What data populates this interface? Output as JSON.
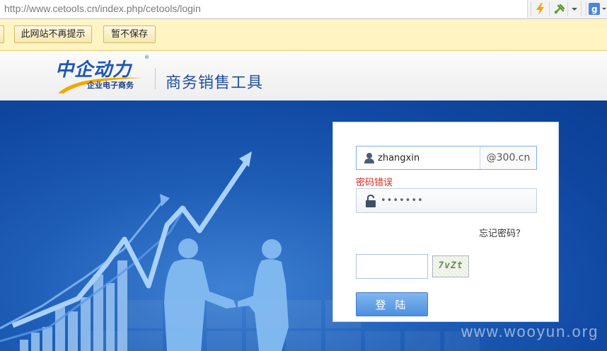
{
  "browser": {
    "url": "http://www.cetools.cn/index.php/cetools/login"
  },
  "notification_bar": {
    "never_save_label": "此网站不再提示",
    "not_now_label": "暂不保存"
  },
  "header": {
    "logo_text": "中企动力",
    "logo_subtitle": "企业电子商务",
    "app_title": "商务销售工具"
  },
  "login": {
    "username_value": "zhangxin",
    "domain_suffix": "@300.cn",
    "error_message": "密码错误",
    "password_value": "•••••••",
    "forgot_password_label": "忘记密码？",
    "captcha_value": "",
    "captcha_text": "7vZt",
    "login_button_label": "登 陆"
  },
  "watermark": "www.wooyun.org",
  "colors": {
    "brand_blue": "#1e56b4",
    "hero_blue": "#0f47a1",
    "error_red": "#d52a1f",
    "notify_yellow": "#fff4c2"
  }
}
